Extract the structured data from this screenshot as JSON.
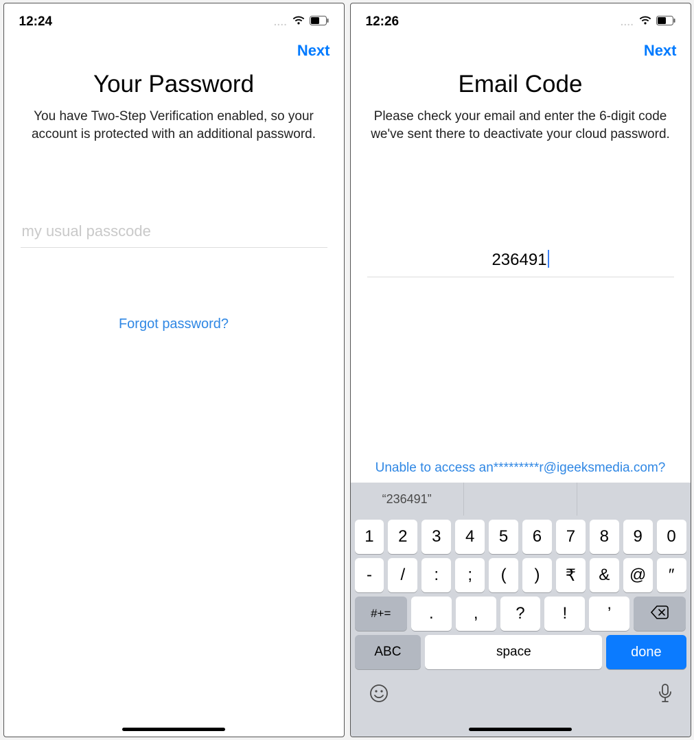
{
  "left": {
    "status": {
      "time": "12:24",
      "dots": "....",
      "wifi": "wifi-icon",
      "battery": "battery-icon"
    },
    "nav": {
      "next": "Next"
    },
    "title": "Your Password",
    "subtitle": "You have Two-Step Verification enabled, so your account is protected with an additional password.",
    "password": {
      "placeholder": "my usual passcode",
      "value": ""
    },
    "forgot": "Forgot password?"
  },
  "right": {
    "status": {
      "time": "12:26",
      "dots": "....",
      "wifi": "wifi-icon",
      "battery": "battery-icon"
    },
    "nav": {
      "next": "Next"
    },
    "title": "Email Code",
    "subtitle": "Please check your email and enter the 6-digit code we've sent there to deactivate your cloud password.",
    "code": {
      "value": "236491"
    },
    "unable": "Unable to access an*********r@igeeksmedia.com?",
    "keyboard": {
      "suggestion": "“236491”",
      "row1": [
        "1",
        "2",
        "3",
        "4",
        "5",
        "6",
        "7",
        "8",
        "9",
        "0"
      ],
      "row2": [
        "-",
        "/",
        ":",
        ";",
        "(",
        ")",
        "₹",
        "&",
        "@",
        "″"
      ],
      "row3_mod": "#+=",
      "row3": [
        ".",
        ",",
        "?",
        "!",
        "’"
      ],
      "row3_bksp": "backspace",
      "row4": {
        "abc": "ABC",
        "space": "space",
        "done": "done"
      },
      "footer": {
        "emoji": "emoji-icon",
        "mic": "mic-icon"
      }
    }
  }
}
